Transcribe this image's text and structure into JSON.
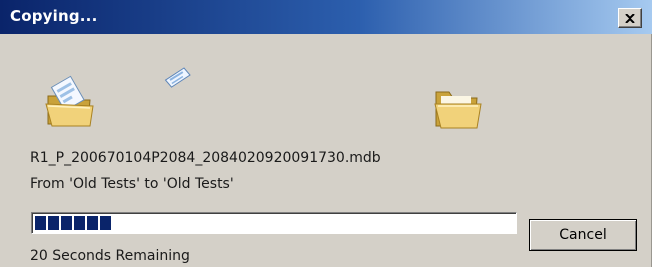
{
  "window": {
    "title": "Copying...",
    "close_glyph": "×"
  },
  "icons": {
    "source": "folder-with-document-icon",
    "flying": "flying-document-icon",
    "destination": "open-folder-icon"
  },
  "file": {
    "name": "R1_P_200670104P2084_2084020920091730.mdb",
    "route": "From 'Old Tests' to 'Old Tests'"
  },
  "progress": {
    "blocks_filled": 6,
    "percent": 16
  },
  "buttons": {
    "cancel": "Cancel"
  },
  "status": {
    "remaining": "20 Seconds Remaining"
  },
  "colors": {
    "title_start": "#0a246a",
    "title_end": "#a6caf0",
    "progress": "#0a246a",
    "face": "#d4d0c8"
  }
}
